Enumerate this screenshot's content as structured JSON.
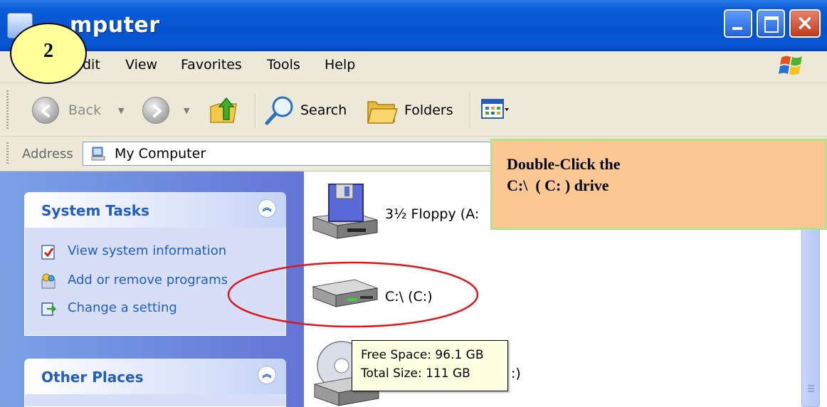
{
  "window": {
    "title": "My Computer",
    "title_visible": "mputer"
  },
  "menu": {
    "items": [
      {
        "label": "dit",
        "full_label": "Edit"
      },
      {
        "label": "View"
      },
      {
        "label": "Favorites"
      },
      {
        "label": "Tools"
      },
      {
        "label": "Help"
      }
    ]
  },
  "toolbar": {
    "back_label": "Back",
    "search_label": "Search",
    "folders_label": "Folders"
  },
  "address": {
    "label": "Address",
    "value": "My Computer"
  },
  "taskpane": {
    "system_tasks": {
      "title": "System Tasks",
      "items": [
        {
          "label": "View system information",
          "icon": "system-info-icon"
        },
        {
          "label": "Add or remove programs",
          "icon": "add-remove-programs-icon"
        },
        {
          "label": "Change a setting",
          "icon": "control-panel-icon"
        }
      ]
    },
    "other_places": {
      "title": "Other Places"
    }
  },
  "drives": [
    {
      "label": "3½ Floppy (A:",
      "icon": "floppy-drive-icon"
    },
    {
      "label": "C:\\ (C:)",
      "icon": "hard-drive-icon"
    },
    {
      "label": ":)",
      "icon": "cd-drive-icon"
    }
  ],
  "tooltip": {
    "free_space": "Free Space: 96.1 GB",
    "total_size": "Total Size: 111 GB"
  },
  "callout": {
    "line1": "Double-Click the",
    "line2": "C:\\  ( C: ) drive"
  },
  "step_badge": {
    "number": "2"
  },
  "colors": {
    "titlebar": "#0652d0",
    "taskpane_link": "#215dc6",
    "callout_fill": "#fbc893",
    "callout_border": "#b8e08a",
    "highlight_ellipse": "#e0161b",
    "badge_fill": "#ffff99",
    "tooltip_fill": "#ffffe1"
  }
}
